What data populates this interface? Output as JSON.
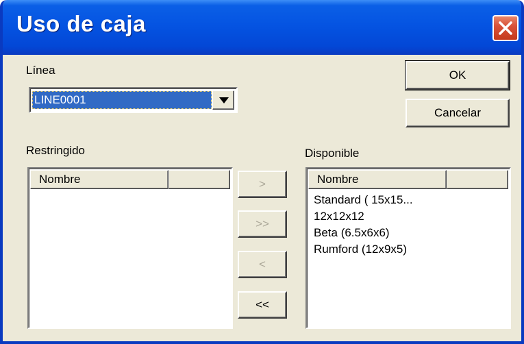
{
  "window": {
    "title": "Uso de caja",
    "close_icon": "close-icon"
  },
  "line": {
    "label": "Línea",
    "selected": "LINE0001",
    "dropdown_icon": "chevron-down-icon"
  },
  "buttons": {
    "ok": "OK",
    "cancel": "Cancelar",
    "move_right": ">",
    "move_all_right": ">>",
    "move_left": "<",
    "move_all_left": "<<"
  },
  "restricted": {
    "label": "Restringido",
    "column": "Nombre",
    "items": []
  },
  "available": {
    "label": "Disponible",
    "column": "Nombre",
    "items": [
      "Standard ( 15x15...",
      "12x12x12",
      "Beta (6.5x6x6)",
      "Rumford (12x9x5)"
    ]
  },
  "colors": {
    "titlebar": "#0554e2",
    "dialog_bg": "#ece9d8",
    "selection": "#316ac5",
    "close_button": "#d9533a",
    "disabled_text": "#aca899"
  }
}
